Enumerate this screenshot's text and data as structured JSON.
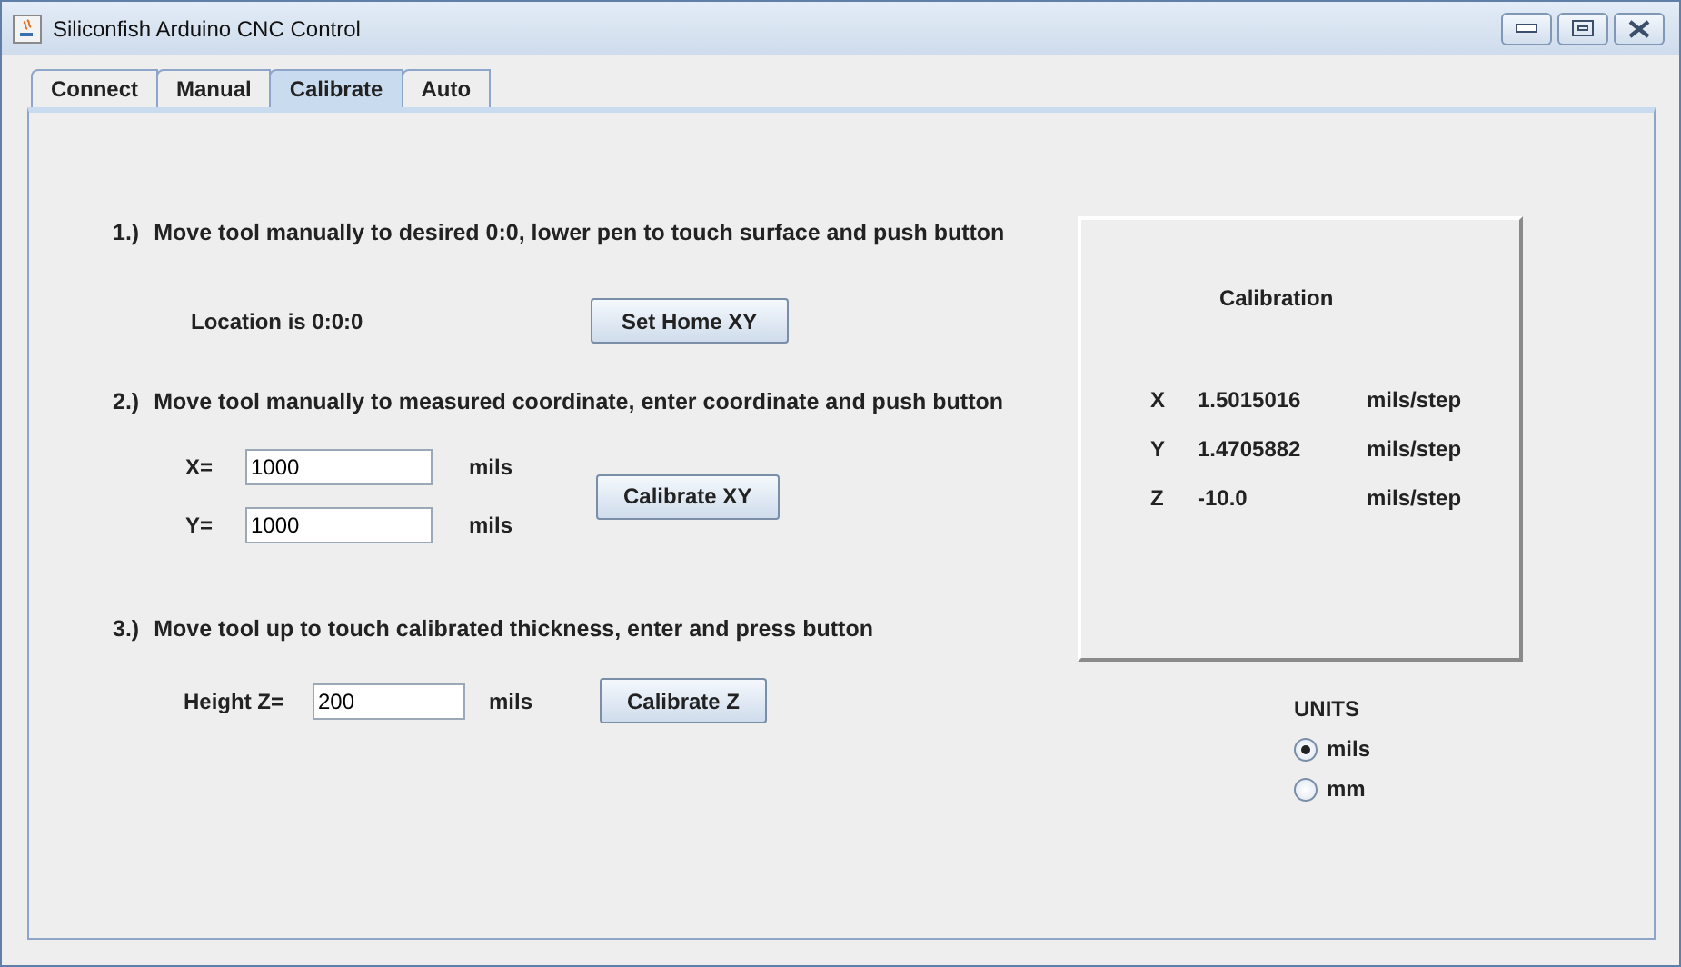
{
  "window": {
    "title": "Siliconfish Arduino CNC Control"
  },
  "tabs": [
    {
      "label": "Connect",
      "selected": false
    },
    {
      "label": "Manual",
      "selected": false
    },
    {
      "label": "Calibrate",
      "selected": true
    },
    {
      "label": "Auto",
      "selected": false
    }
  ],
  "step_1": {
    "number": "1.)",
    "text": "Move tool manually to desired 0:0, lower pen to touch surface and push button",
    "location": "Location is 0:0:0",
    "button": "Set Home XY"
  },
  "step_2": {
    "number": "2.)",
    "text": "Move tool manually to measured coordinate, enter coordinate and push button",
    "fields": [
      {
        "label": "X=",
        "value": "1000",
        "unit": "mils"
      },
      {
        "label": "Y=",
        "value": "1000",
        "unit": "mils"
      }
    ],
    "button": "Calibrate XY"
  },
  "step_3": {
    "number": "3.)",
    "text": "Move tool up to touch calibrated thickness, enter and press button",
    "field": {
      "label": "Height Z=",
      "value": "200",
      "unit": "mils"
    },
    "button": "Calibrate Z"
  },
  "calibration": {
    "title": "Calibration",
    "rows": [
      {
        "axis": "X",
        "value": "1.5015016",
        "unit": "mils/step"
      },
      {
        "axis": "Y",
        "value": "1.4705882",
        "unit": "mils/step"
      },
      {
        "axis": "Z",
        "value": "-10.0",
        "unit": "mils/step"
      }
    ]
  },
  "units": {
    "label": "UNITS",
    "options": [
      {
        "label": "mils",
        "selected": true
      },
      {
        "label": "mm",
        "selected": false
      }
    ]
  }
}
